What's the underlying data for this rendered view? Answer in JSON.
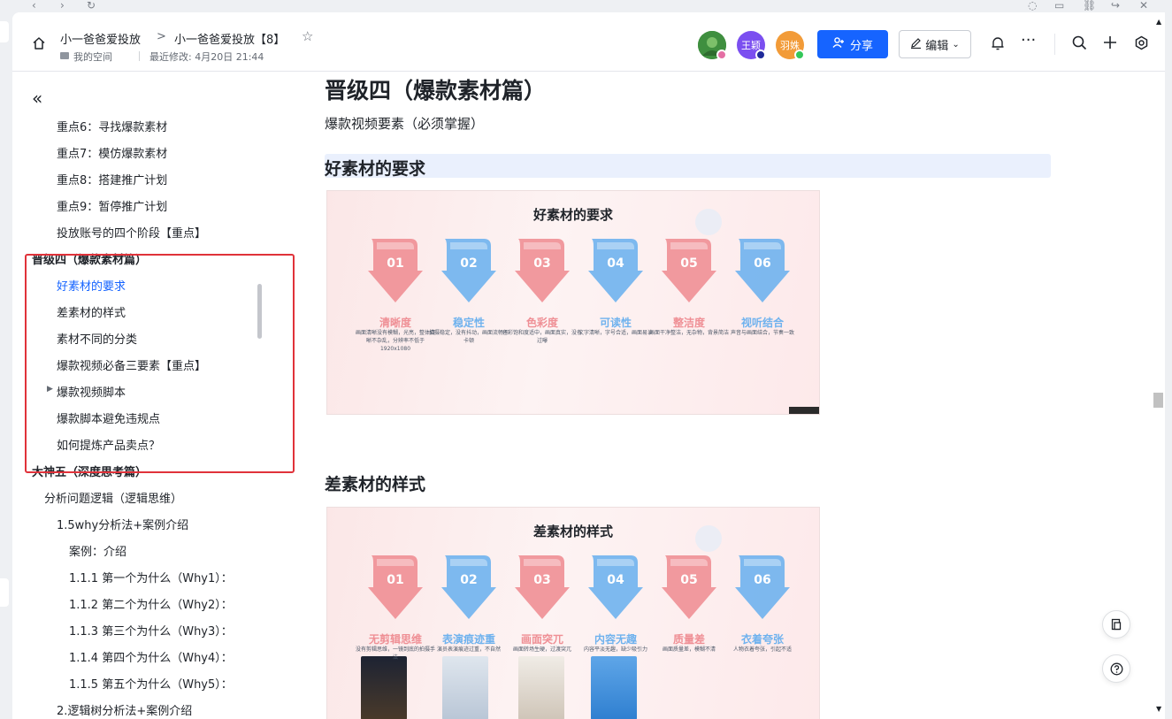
{
  "header": {
    "breadcrumb_parent": "小一爸爸爱投放",
    "breadcrumb_sep": ">",
    "doc_title": "小一爸爸爱投放【8】",
    "space": "我的空间",
    "last_modified": "最近修改: 4月20日 21:44",
    "collaborators": [
      {
        "label": "",
        "color": "#3f8f3f",
        "status": "#e46fa4"
      },
      {
        "label": "王颖",
        "color": "#7b4ff0",
        "status": "#1f2a9a"
      },
      {
        "label": "羽姝",
        "color": "#f29b38",
        "status": "#34c759"
      }
    ],
    "share_label": "分享",
    "edit_label": "编辑"
  },
  "sidebar": {
    "items": [
      {
        "label": "重点6：寻找爆款素材"
      },
      {
        "label": "重点7：模仿爆款素材"
      },
      {
        "label": "重点8：搭建推广计划"
      },
      {
        "label": "重点9：暂停推广计划"
      },
      {
        "label": "投放账号的四个阶段【重点】"
      },
      {
        "label": "晋级四（爆款素材篇）"
      },
      {
        "label": "好素材的要求"
      },
      {
        "label": "差素材的样式"
      },
      {
        "label": "素材不同的分类"
      },
      {
        "label": "爆款视频必备三要素【重点】"
      },
      {
        "label": "爆款视频脚本"
      },
      {
        "label": "爆款脚本避免违规点"
      },
      {
        "label": "如何提炼产品卖点？"
      },
      {
        "label": "大神五（深度思考篇）"
      },
      {
        "label": "分析问题逻辑（逻辑思维）"
      },
      {
        "label": "1.5why分析法+案例介绍"
      },
      {
        "label": "案例：介绍"
      },
      {
        "label": "1.1.1 第一个为什么（Why1）："
      },
      {
        "label": "1.1.2 第二个为什么（Why2）："
      },
      {
        "label": "1.1.3 第三个为什么（Why3）："
      },
      {
        "label": "1.1.4 第四个为什么（Why4）："
      },
      {
        "label": "1.1.5 第五个为什么（Why5）："
      },
      {
        "label": "2.逻辑树分析法+案例介绍"
      }
    ]
  },
  "doc": {
    "heading1": "晋级四（爆款素材篇）",
    "intro": "爆款视频要素（必须掌握）",
    "section1_heading": "好素材的要求",
    "section2_heading": "差素材的样式",
    "slide1": {
      "title": "好素材的要求",
      "items": [
        {
          "num": "01",
          "label": "清晰度",
          "color": "pink",
          "desc": "画面清晰没有模糊，光亮，整体清晰不杂乱，分辨率不低于1920x1080"
        },
        {
          "num": "02",
          "label": "稳定性",
          "color": "blue",
          "desc": "拍摄稳定，没有抖动，画面流畅不卡顿"
        },
        {
          "num": "03",
          "label": "色彩度",
          "color": "pink",
          "desc": "色彩饱和度适中，画面真实，没有过曝"
        },
        {
          "num": "04",
          "label": "可读性",
          "color": "blue",
          "desc": "文字清晰，字号合适，画面易读"
        },
        {
          "num": "05",
          "label": "整洁度",
          "color": "pink",
          "desc": "画面干净整洁，无杂物，背景简洁"
        },
        {
          "num": "06",
          "label": "视听结合",
          "color": "blue",
          "desc": "声音与画面结合，节奏一致"
        }
      ]
    },
    "slide2": {
      "title": "差素材的样式",
      "items": [
        {
          "num": "01",
          "label": "无剪辑思维",
          "color": "pink",
          "desc": "没有剪辑思维，一镜到底的拍摄手法"
        },
        {
          "num": "02",
          "label": "表演痕迹重",
          "color": "blue",
          "desc": "演员表演痕迹过重，不自然"
        },
        {
          "num": "03",
          "label": "画面突兀",
          "color": "pink",
          "desc": "画面转场生硬，过渡突兀"
        },
        {
          "num": "04",
          "label": "内容无趣",
          "color": "blue",
          "desc": "内容平淡无趣，缺少吸引力"
        },
        {
          "num": "05",
          "label": "质量差",
          "color": "pink",
          "desc": "画面质量差，模糊不清"
        },
        {
          "num": "06",
          "label": "衣着夸张",
          "color": "blue",
          "desc": "人物衣着夸张，引起不适"
        }
      ]
    }
  },
  "colors": {
    "accent": "#1664ff",
    "highlight_box": "#e0323a",
    "pink_arrow": "#ef8f95",
    "blue_arrow": "#6fb2ee"
  }
}
